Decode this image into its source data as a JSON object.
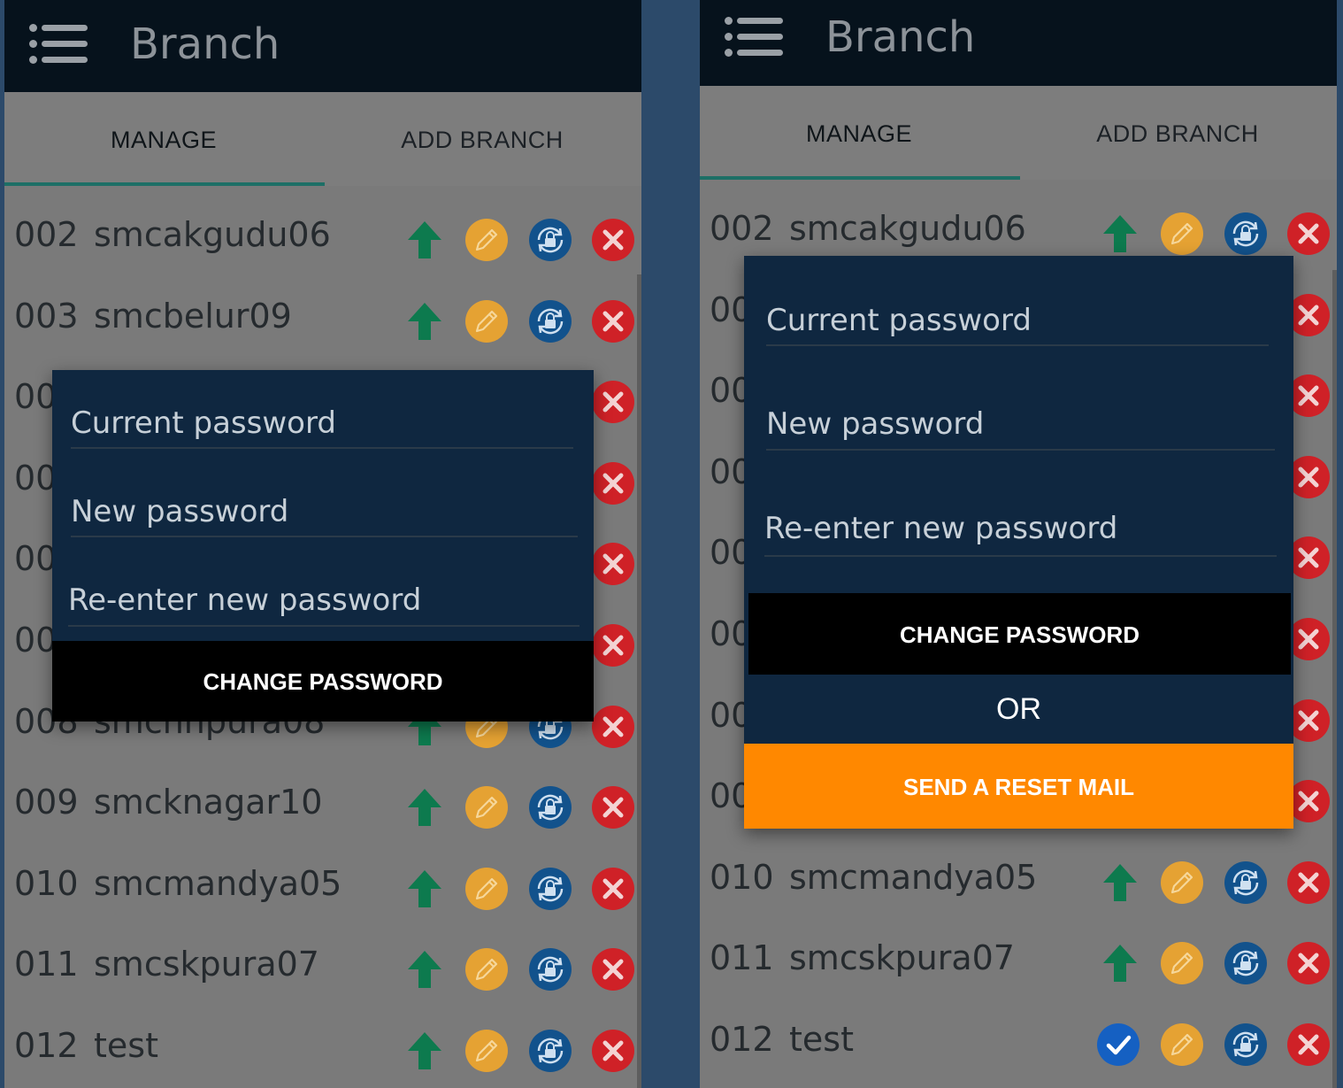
{
  "app": {
    "title": "Branch",
    "menu_icon": "hamburger-menu-icon"
  },
  "tabs": {
    "manage": "MANAGE",
    "add_branch": "ADD BRANCH"
  },
  "colors": {
    "topbar": "#06121c",
    "tab_indicator": "#1d6f66",
    "dialog": "#0f2740",
    "up": "#0d7a4e",
    "edit": "#e5a233",
    "lock": "#12528c",
    "delete": "#cf2127",
    "reset": "#ff8800"
  },
  "left": {
    "rows": [
      {
        "num": "002",
        "name": "smcakgudu06"
      },
      {
        "num": "003",
        "name": "smcbelur09"
      },
      {
        "num": "00",
        "name": ""
      },
      {
        "num": "00",
        "name": ""
      },
      {
        "num": "00",
        "name": ""
      },
      {
        "num": "00",
        "name": ""
      },
      {
        "num": "008",
        "name": "smchnpura08"
      },
      {
        "num": "009",
        "name": "smcknagar10"
      },
      {
        "num": "010",
        "name": "smcmandya05"
      },
      {
        "num": "011",
        "name": "smcskpura07"
      },
      {
        "num": "012",
        "name": "test"
      }
    ],
    "dialog": {
      "current_password": "Current password",
      "new_password": "New password",
      "reenter_password": "Re-enter new password",
      "change_button": "CHANGE PASSWORD"
    }
  },
  "right": {
    "rows": [
      {
        "num": "002",
        "name": "smcakgudu06"
      },
      {
        "num": "00",
        "name": ""
      },
      {
        "num": "00",
        "name": ""
      },
      {
        "num": "00",
        "name": ""
      },
      {
        "num": "00",
        "name": ""
      },
      {
        "num": "00",
        "name": ""
      },
      {
        "num": "00",
        "name": ""
      },
      {
        "num": "00",
        "name": ""
      },
      {
        "num": "010",
        "name": "smcmandya05"
      },
      {
        "num": "011",
        "name": "smcskpura07"
      },
      {
        "num": "012",
        "name": "test"
      }
    ],
    "dialog": {
      "current_password": "Current password",
      "new_password": "New password",
      "reenter_password": "Re-enter new password",
      "change_button": "CHANGE PASSWORD",
      "or_text": "OR",
      "reset_button": "SEND A RESET MAIL"
    }
  }
}
